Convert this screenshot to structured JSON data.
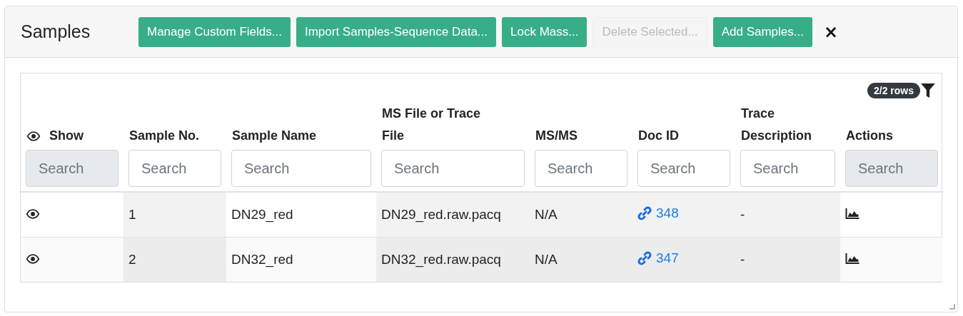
{
  "modal": {
    "title": "Samples",
    "buttons": [
      {
        "label": "Manage Custom Fields...",
        "disabled": false
      },
      {
        "label": "Import Samples-Sequence Data...",
        "disabled": false
      },
      {
        "label": "Lock Mass...",
        "disabled": false
      },
      {
        "label": "Delete Selected...",
        "disabled": true
      },
      {
        "label": "Add Samples...",
        "disabled": false
      }
    ],
    "close": "×"
  },
  "table": {
    "row_count": "2/2 rows",
    "columns": [
      {
        "label": "Show",
        "kind": "eye",
        "shaded": false,
        "search": {
          "placeholder": "Search",
          "disabled": true
        }
      },
      {
        "label": "Sample No.",
        "kind": "text",
        "shaded": true,
        "search": {
          "placeholder": "Search",
          "disabled": false
        }
      },
      {
        "label": "Sample Name",
        "kind": "text",
        "shaded": false,
        "search": {
          "placeholder": "Search",
          "disabled": false
        }
      },
      {
        "label": "MS File or Trace File",
        "kind": "text",
        "shaded": true,
        "search": {
          "placeholder": "Search",
          "disabled": false
        }
      },
      {
        "label": "MS/MS",
        "kind": "text",
        "shaded": true,
        "search": {
          "placeholder": "Search",
          "disabled": false
        }
      },
      {
        "label": "Doc ID",
        "kind": "link",
        "shaded": true,
        "search": {
          "placeholder": "Search",
          "disabled": false
        }
      },
      {
        "label": "Trace Description",
        "kind": "text",
        "shaded": true,
        "search": {
          "placeholder": "Search",
          "disabled": false
        }
      },
      {
        "label": "Actions",
        "kind": "chart",
        "shaded": false,
        "search": {
          "placeholder": "Search",
          "disabled": true
        }
      }
    ],
    "rows": [
      [
        "",
        "1",
        "DN29_red",
        "DN29_red.raw.pacq",
        "N/A",
        "348",
        "-",
        ""
      ],
      [
        "",
        "2",
        "DN32_red",
        "DN32_red.raw.pacq",
        "N/A",
        "347",
        "-",
        ""
      ]
    ]
  }
}
